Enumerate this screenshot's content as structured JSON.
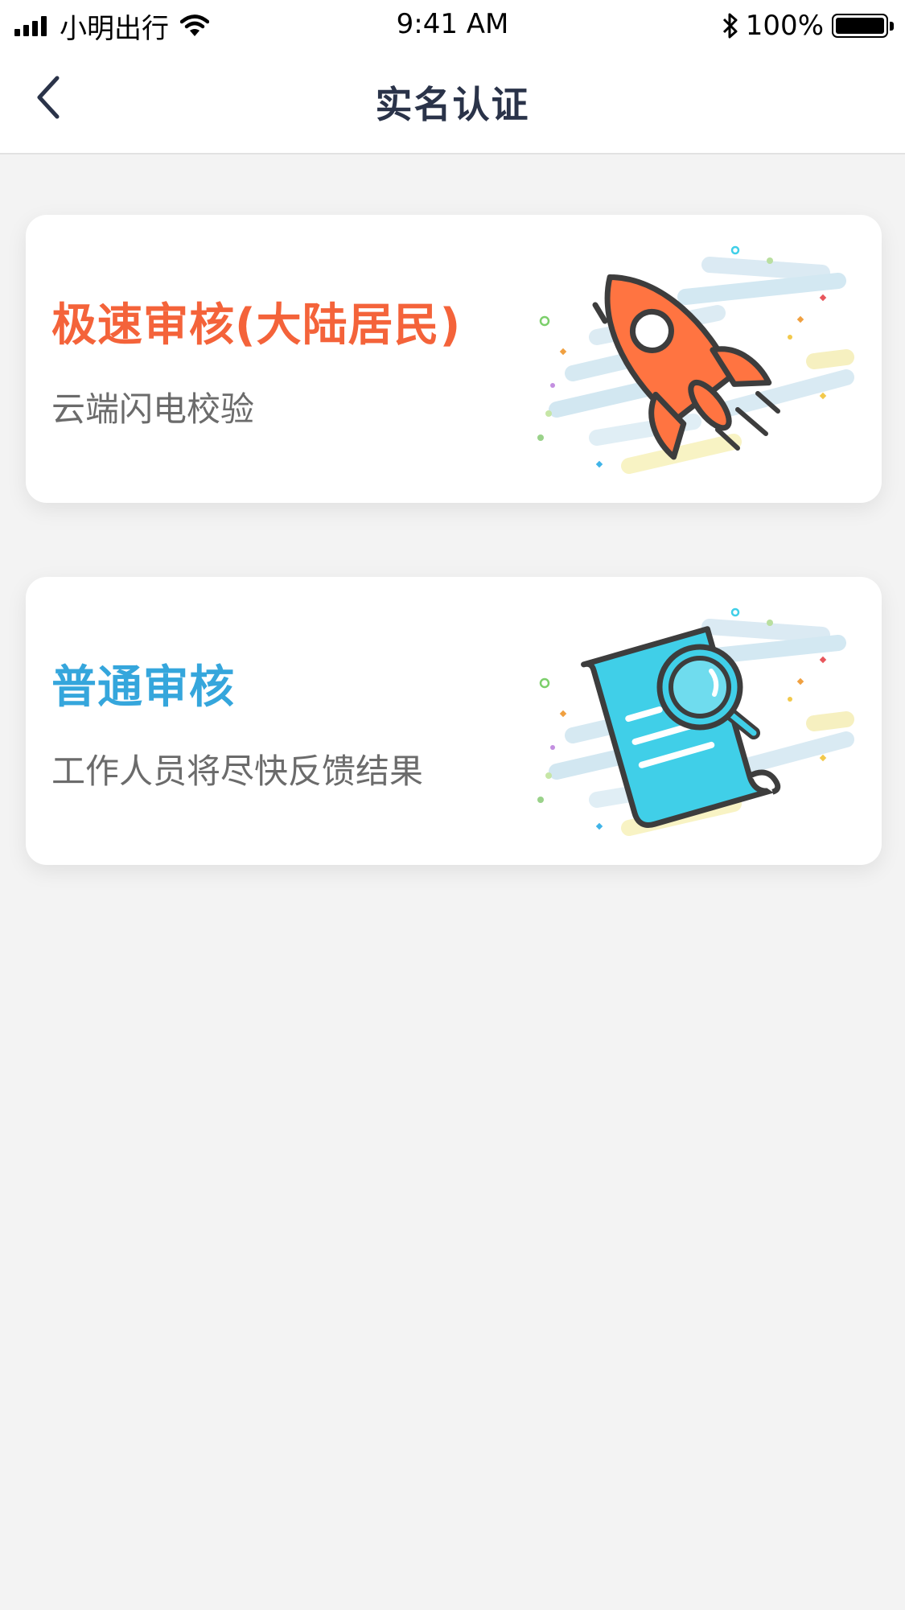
{
  "status_bar": {
    "carrier": "小明出行",
    "time": "9:41 AM",
    "battery_percent": "100%",
    "battery_level": 1.0
  },
  "nav": {
    "title": "实名认证",
    "back_icon": "chevron-left-icon"
  },
  "options": [
    {
      "title": "极速审核(大陆居民)",
      "subtitle": "云端闪电校验",
      "title_color": "#f4633a",
      "illustration": "rocket-icon"
    },
    {
      "title": "普通审核",
      "subtitle": "工作人员将尽快反馈结果",
      "title_color": "#35a6dc",
      "illustration": "document-search-icon"
    }
  ],
  "colors": {
    "background": "#f3f3f3",
    "card": "#ffffff",
    "nav_title": "#2a3349",
    "subtitle": "#6b6b6b",
    "rocket": "#ff7441",
    "document": "#40cfe8",
    "outline": "#3d3d3d"
  }
}
